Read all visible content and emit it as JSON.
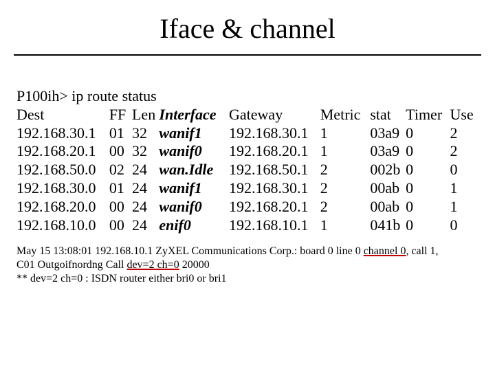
{
  "title": "Iface & channel",
  "prompt": "P100ih> ip route status",
  "headers": {
    "dest": "Dest",
    "ff": "FF",
    "len": "Len",
    "iface": "Interface",
    "gateway": "Gateway",
    "metric": "Metric",
    "stat": "stat",
    "timer": "Timer",
    "use": "Use"
  },
  "rows": [
    {
      "dest": "192.168.30.1",
      "ff": "01",
      "len": "32",
      "iface": "wanif1",
      "gateway": "192.168.30.1",
      "metric": "1",
      "stat": "03a9",
      "timer": "0",
      "use": "2"
    },
    {
      "dest": "192.168.20.1",
      "ff": "00",
      "len": "32",
      "iface": "wanif0",
      "gateway": "192.168.20.1",
      "metric": "1",
      "stat": "03a9",
      "timer": "0",
      "use": "2"
    },
    {
      "dest": "192.168.50.0",
      "ff": "02",
      "len": "24",
      "iface": "wan.Idle",
      "gateway": "192.168.50.1",
      "metric": "2",
      "stat": "002b",
      "timer": "0",
      "use": "0"
    },
    {
      "dest": "192.168.30.0",
      "ff": "01",
      "len": "24",
      "iface": "wanif1",
      "gateway": "192.168.30.1",
      "metric": "2",
      "stat": "00ab",
      "timer": "0",
      "use": "1"
    },
    {
      "dest": "192.168.20.0",
      "ff": "00",
      "len": "24",
      "iface": "wanif0",
      "gateway": "192.168.20.1",
      "metric": "2",
      "stat": "00ab",
      "timer": "0",
      "use": "1"
    },
    {
      "dest": "192.168.10.0",
      "ff": "00",
      "len": "24",
      "iface": "enif0",
      "gateway": "192.168.10.1",
      "metric": "1",
      "stat": "041b",
      "timer": "0",
      "use": "0"
    }
  ],
  "log": {
    "l1a": "May 15 13:08:01 192.168.10.1 ZyXEL Communications Corp.: board 0 line 0 ",
    "l1b": "channel 0",
    "l1c": ", call 1,",
    "l2a": "C01 Outgoifnordng Call ",
    "l2b": "dev=2 ch=0",
    "l2c": " 20000",
    "l3": "** dev=2 ch=0 : ISDN router either bri0 or bri1"
  }
}
